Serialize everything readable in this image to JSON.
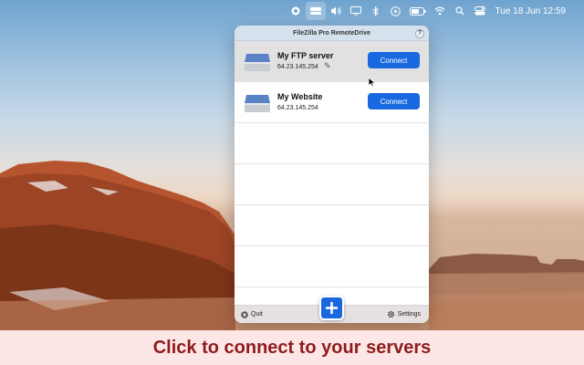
{
  "menubar": {
    "icons": [
      "record-icon",
      "remotedrive-icon",
      "volume-icon",
      "display-icon",
      "bluetooth-icon",
      "play-icon",
      "battery-icon",
      "wifi-icon",
      "search-icon",
      "control-center-icon"
    ],
    "datetime": "Tue 18 Jun  12:59"
  },
  "window": {
    "title": "FileZilla Pro RemoteDrive",
    "help_label": "?"
  },
  "servers": [
    {
      "name": "My FTP server",
      "host": "64.23.145.254",
      "connect_label": "Connect"
    },
    {
      "name": "My Website",
      "host": "64.23.145.254",
      "connect_label": "Connect"
    }
  ],
  "footer": {
    "quit_label": "Quit",
    "settings_label": "Settings"
  },
  "caption": "Click to connect to your servers",
  "colors": {
    "accent": "#1968e0",
    "caption_text": "#8f1b1b",
    "caption_bg": "#fde7e6"
  }
}
